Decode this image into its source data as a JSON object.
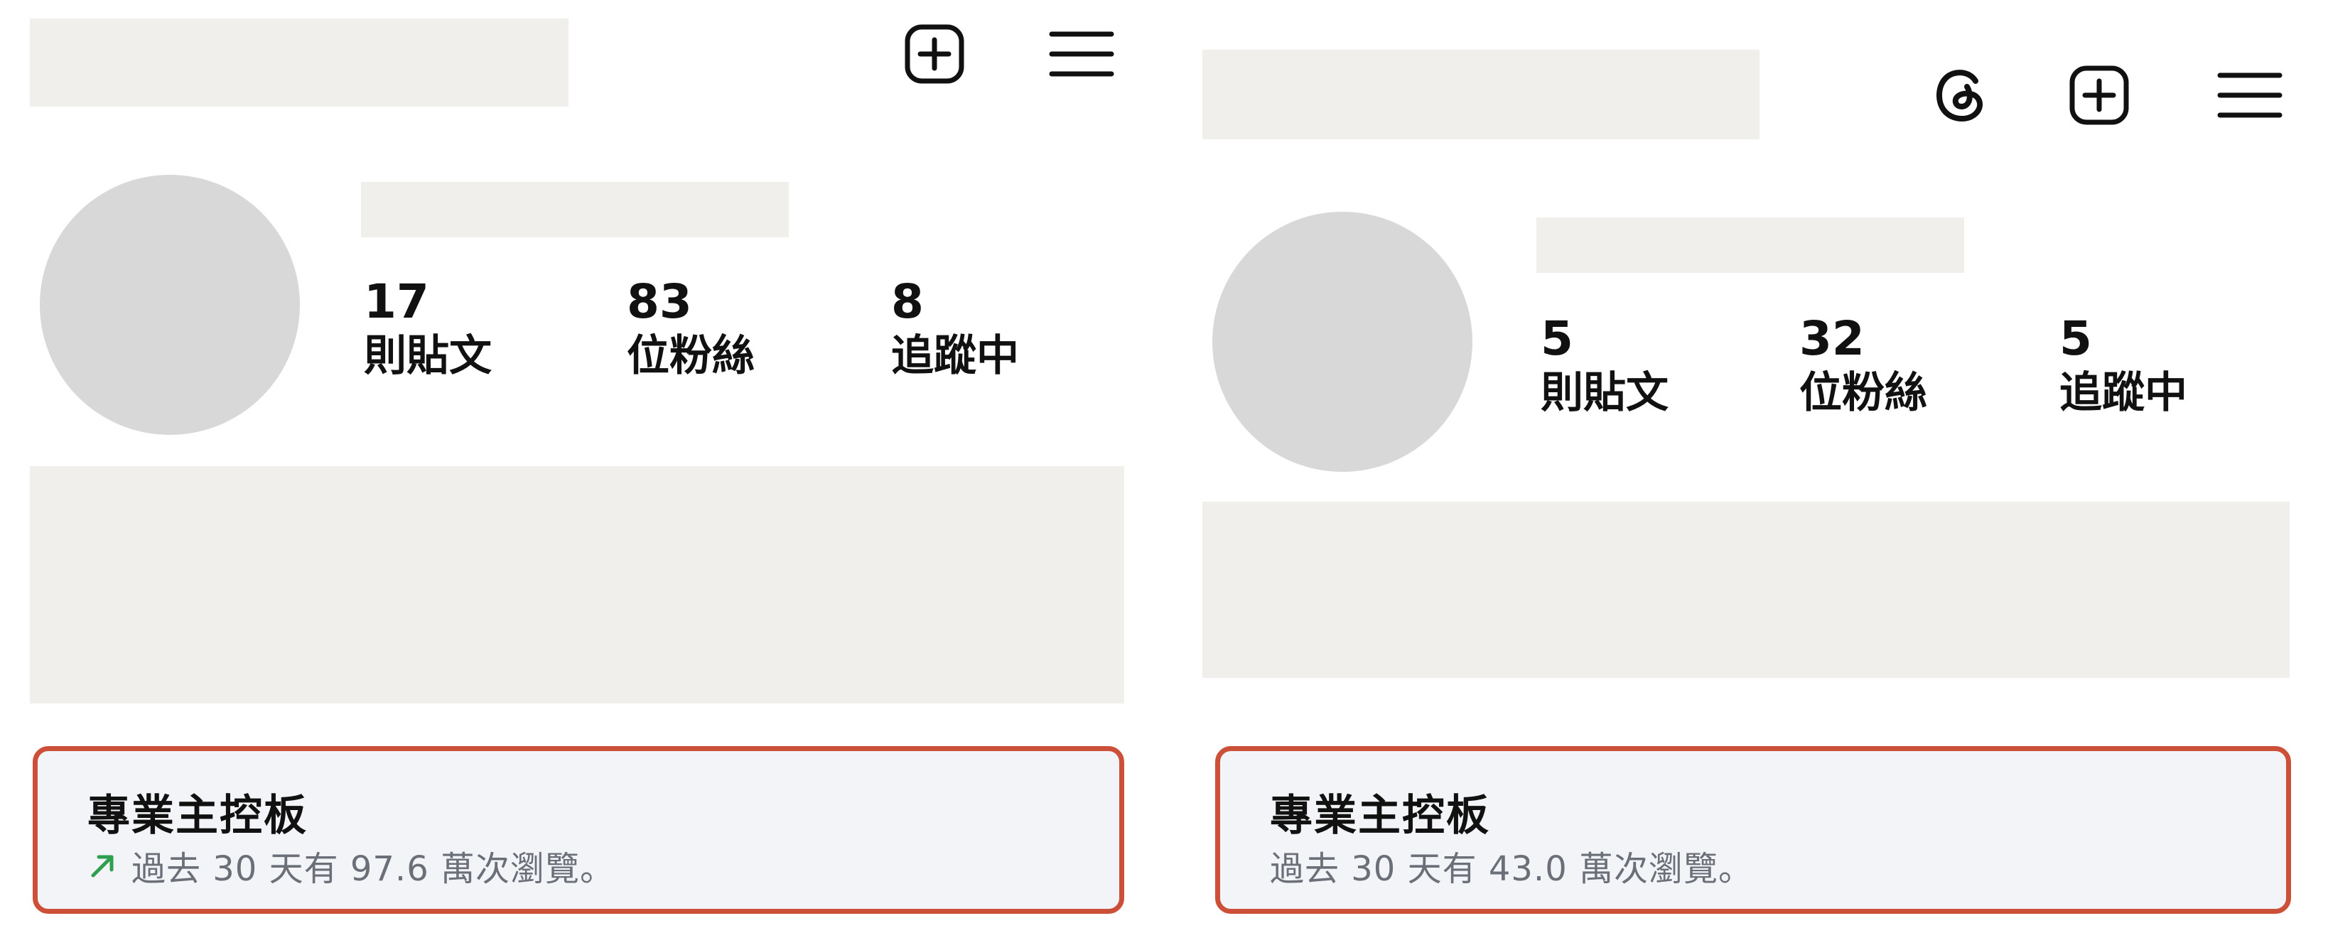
{
  "left_panel": {
    "stats": [
      {
        "value": "17",
        "label": "則貼文"
      },
      {
        "value": "83",
        "label": "位粉絲"
      },
      {
        "value": "8",
        "label": "追蹤中"
      }
    ],
    "dashboard": {
      "title": "專業主控板",
      "trend_icon": "trend-up-arrow-icon",
      "trend_color": "#2e9e4f",
      "summary": "過去 30 天有 97.6 萬次瀏覽。"
    },
    "header_icons": [
      "plus-square-icon",
      "menu-icon"
    ]
  },
  "right_panel": {
    "stats": [
      {
        "value": "5",
        "label": "則貼文"
      },
      {
        "value": "32",
        "label": "位粉絲"
      },
      {
        "value": "5",
        "label": "追蹤中"
      }
    ],
    "dashboard": {
      "title": "專業主控板",
      "summary": "過去 30 天有 43.0 萬次瀏覽。"
    },
    "header_icons": [
      "threads-icon",
      "plus-square-icon",
      "menu-icon"
    ]
  },
  "colors": {
    "highlight_border": "#cc5038",
    "placeholder": "#f0efec",
    "avatar": "#d8d8d8"
  }
}
